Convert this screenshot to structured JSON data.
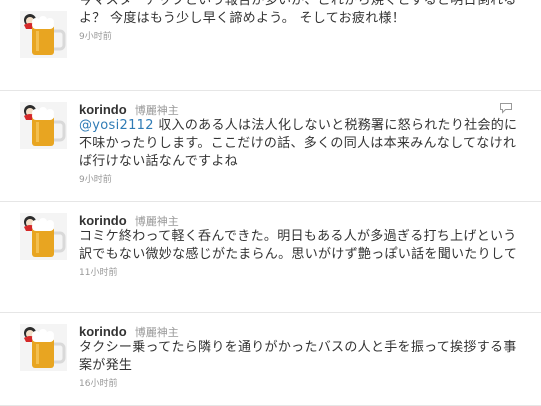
{
  "tweets": [
    {
      "screen_name": "",
      "full_name": "",
      "text_prefix": "",
      "mention": "",
      "text": "今マスターアップという報告が多いが、これから焼くとすると明日倒れるよ？ 今度はもう少し早く諦めよう。 そしてお疲れ様！",
      "time": "9小时前"
    },
    {
      "screen_name": "korindo",
      "full_name": "博麗神主",
      "mention": "@yosi2112",
      "text": " 収入のある人は法人化しないと税務署に怒られたり社会的に不味かったりします。ここだけの話、多くの同人は本来みんなしてなければ行けない話なんですよね",
      "time": "9小时前"
    },
    {
      "screen_name": "korindo",
      "full_name": "博麗神主",
      "mention": "",
      "text": "コミケ終わって軽く呑んできた。明日もある人が多過ぎる打ち上げという訳でもない微妙な感じがたまらん。思いがけず艶っぽい話を聞いたりして",
      "time": "11小时前"
    },
    {
      "screen_name": "korindo",
      "full_name": "博麗神主",
      "mention": "",
      "text": "タクシー乗ってたら隣りを通りがかったバスの人と手を振って挨拶する事案が発生",
      "time": "16小时前"
    }
  ],
  "icons": {
    "avatar": "beer-mug-avatar",
    "reply": "reply-icon"
  },
  "colors": {
    "link": "#2f7bb5",
    "text": "#333333",
    "meta": "#999999",
    "divider": "#e6e6e6"
  }
}
